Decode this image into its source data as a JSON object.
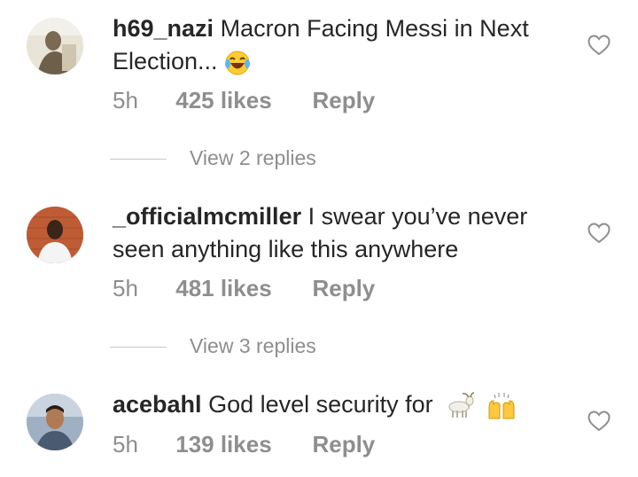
{
  "comments": [
    {
      "username": "h69_nazi",
      "text": "Macron Facing Messi in Next Election...",
      "emoji": "laughing-tears",
      "time": "5h",
      "likes": "425 likes",
      "reply": "Reply",
      "view_replies": "View 2 replies"
    },
    {
      "username": "_officialmcmiller",
      "text": "I swear you’ve never seen anything like this anywhere",
      "time": "5h",
      "likes": "481 likes",
      "reply": "Reply",
      "view_replies": "View 3 replies"
    },
    {
      "username": "acebahl",
      "text": "God level security for",
      "emoji": "goat raised-hands",
      "time": "5h",
      "likes": "139 likes",
      "reply": "Reply"
    }
  ],
  "colors": {
    "text": "#262626",
    "secondary": "#8e8e8e",
    "divider": "#c7c7c7"
  }
}
